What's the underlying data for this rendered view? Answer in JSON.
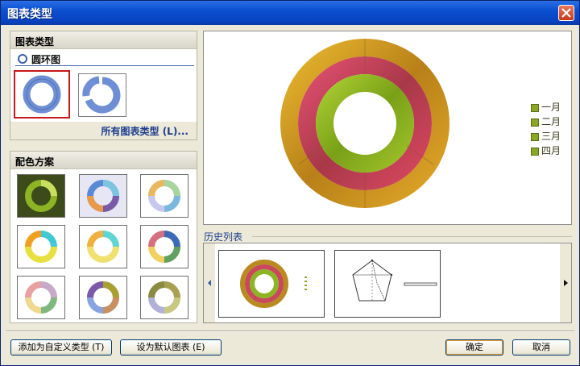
{
  "window": {
    "title": "图表类型"
  },
  "chart_type_panel": {
    "header": "图表类型",
    "subtype_label": "圆环图",
    "all_types_link": "所有图表类型 (L)..."
  },
  "color_scheme_panel": {
    "header": "配色方案"
  },
  "preview": {
    "legend": [
      "一月",
      "二月",
      "三月",
      "四月"
    ]
  },
  "history": {
    "label": "历史列表"
  },
  "buttons": {
    "add_custom": "添加为自定义类型 (T)",
    "set_default": "设为默认图表 (E)",
    "ok": "确定",
    "cancel": "取消"
  },
  "colors": {
    "outer_ring": "#c89418",
    "middle_ring": "#c8485c",
    "inner_ring": "#8cb424",
    "title_bar": "#0a4fd0"
  },
  "icons": [
    "close-icon",
    "radio-icon",
    "chevron-left-icon",
    "chevron-right-icon"
  ]
}
